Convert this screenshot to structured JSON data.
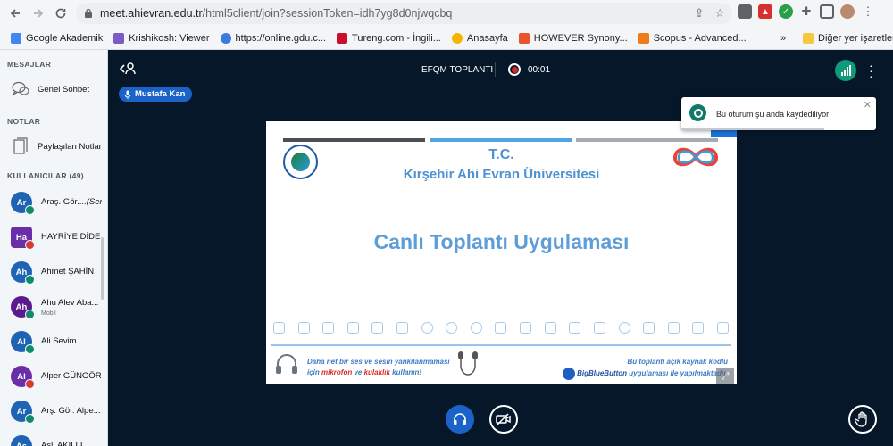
{
  "browser": {
    "url_host": "meet.ahievran.edu.tr",
    "url_path": "/html5client/join?sessionToken=idh7yg8d0njwqcbq",
    "bookmarks": [
      {
        "label": "Google Akademik",
        "color": "#4285f4"
      },
      {
        "label": "Krishikosh: Viewer",
        "color": "#7a5cc4"
      },
      {
        "label": "https://online.gdu.c...",
        "color": "#3a7be0"
      },
      {
        "label": "Tureng.com - İngili...",
        "color": "#c8102e"
      },
      {
        "label": "Anasayfa",
        "color": "#f4b400"
      },
      {
        "label": "HOWEVER Synony...",
        "color": "#e8532b"
      },
      {
        "label": "Scopus - Advanced...",
        "color": "#f07b1a"
      }
    ],
    "other_bookmarks": "Diğer yer işaretleri",
    "more": "»"
  },
  "sidebar": {
    "messages_title": "MESAJLAR",
    "public_chat": "Genel Sohbet",
    "notes_title": "NOTLAR",
    "shared_notes": "Paylaşılan Notlar",
    "users_title": "KULLANICILAR (49)",
    "users": [
      {
        "initials": "Ar",
        "name": "Araş. Gör....",
        "suffix": "(Sen)",
        "color": "#1f63b4",
        "muted": false,
        "shape": "circle"
      },
      {
        "initials": "Ha",
        "name": "HAYRİYE DİDE...",
        "suffix": "",
        "color": "#6a2ea8",
        "muted": true,
        "shape": "square"
      },
      {
        "initials": "Ah",
        "name": "Ahmet ŞAHİN",
        "suffix": "",
        "color": "#1f63b4",
        "muted": false,
        "shape": "circle"
      },
      {
        "initials": "Ah",
        "name": "Ahu Alev Aba...",
        "suffix": "",
        "sub": "Mobil",
        "color": "#5b1b8e",
        "muted": false,
        "shape": "circle"
      },
      {
        "initials": "Al",
        "name": "Ali Sevim",
        "suffix": "",
        "color": "#1f63b4",
        "muted": false,
        "shape": "circle"
      },
      {
        "initials": "Al",
        "name": "Alper GÜNGÖR",
        "suffix": "",
        "color": "#6a2ea8",
        "muted": true,
        "shape": "circle"
      },
      {
        "initials": "Ar",
        "name": "Arş. Gör. Alpe...",
        "suffix": "",
        "color": "#1f63b4",
        "muted": false,
        "shape": "circle"
      },
      {
        "initials": "As",
        "name": "Aslı AKILLI",
        "suffix": "",
        "color": "#1f63b4",
        "muted": false,
        "shape": "circle"
      }
    ]
  },
  "meeting": {
    "title": "EFQM TOPLANTI",
    "record_time": "00:01",
    "talker": "Mustafa Kan",
    "toast": "Bu oturum şu anda kaydediliyor"
  },
  "slide": {
    "tc": "T.C.",
    "university": "Kırşehir Ahi Evran Üniversitesi",
    "headline": "Canlı Toplantı Uygulaması",
    "tip_line1": "Daha net bir ses ve sesin yankılanmaması",
    "tip_line2_pre": "için ",
    "tip_mic": "mikrofon",
    "tip_and": " ve ",
    "tip_headphone": "kulaklık",
    "tip_line2_post": " kullanın!",
    "right_line1": "Bu toplantı açık kaynak kodlu",
    "right_brand": "BigBlueButton",
    "right_line2": " uygulaması ile yapılmaktadır."
  },
  "colors": {
    "stripe_dark": "#4a4f55",
    "stripe_blue": "#4da6e3",
    "stripe_gray": "#a6abb1",
    "accent_blue": "#1b63c8",
    "record_red": "#df2721"
  }
}
